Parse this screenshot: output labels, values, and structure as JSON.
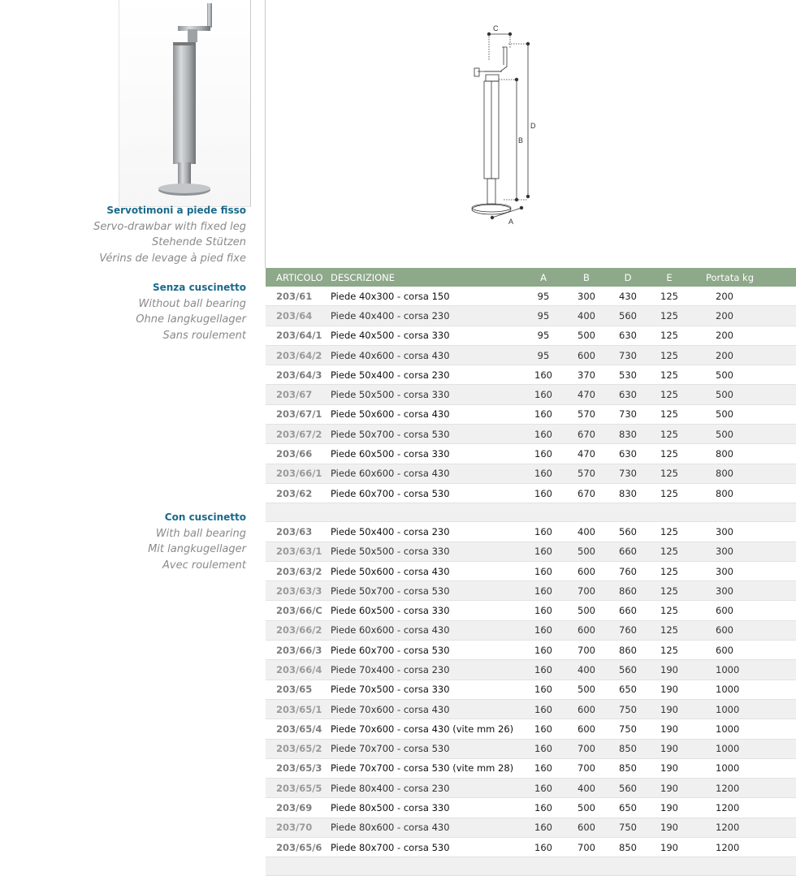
{
  "sections": {
    "main": {
      "title": "Servotimoni a piede fisso",
      "lines": [
        "Servo-drawbar with fixed leg",
        "Stehende Stützen",
        "Vérins de levage à pied fixe"
      ]
    },
    "without": {
      "title": "Senza cuscinetto",
      "lines": [
        "Without ball bearing",
        "Ohne langkugellager",
        "Sans roulement"
      ]
    },
    "with": {
      "title": "Con cuscinetto",
      "lines": [
        "With ball bearing",
        "Mit langkugellager",
        "Avec roulement"
      ]
    }
  },
  "diagram": {
    "labels": {
      "c": "C",
      "d": "D",
      "b": "B",
      "a": "A"
    }
  },
  "table": {
    "headers": [
      "ARTICOLO",
      "DESCRIZIONE",
      "A",
      "B",
      "D",
      "E",
      "Portata kg"
    ],
    "group1": [
      [
        "203/61",
        "Piede 40x300 - corsa 150",
        "95",
        "300",
        "430",
        "125",
        "200"
      ],
      [
        "203/64",
        "Piede 40x400 - corsa 230",
        "95",
        "400",
        "560",
        "125",
        "200"
      ],
      [
        "203/64/1",
        "Piede 40x500 - corsa 330",
        "95",
        "500",
        "630",
        "125",
        "200"
      ],
      [
        "203/64/2",
        "Piede 40x600 - corsa 430",
        "95",
        "600",
        "730",
        "125",
        "200"
      ],
      [
        "203/64/3",
        "Piede 50x400 - corsa 230",
        "160",
        "370",
        "530",
        "125",
        "500"
      ],
      [
        "203/67",
        "Piede 50x500 - corsa 330",
        "160",
        "470",
        "630",
        "125",
        "500"
      ],
      [
        "203/67/1",
        "Piede 50x600 - corsa 430",
        "160",
        "570",
        "730",
        "125",
        "500"
      ],
      [
        "203/67/2",
        "Piede 50x700 - corsa 530",
        "160",
        "670",
        "830",
        "125",
        "500"
      ],
      [
        "203/66",
        "Piede 60x500 - corsa 330",
        "160",
        "470",
        "630",
        "125",
        "800"
      ],
      [
        "203/66/1",
        "Piede 60x600 - corsa 430",
        "160",
        "570",
        "730",
        "125",
        "800"
      ],
      [
        "203/62",
        "Piede 60x700 - corsa 530",
        "160",
        "670",
        "830",
        "125",
        "800"
      ]
    ],
    "group2": [
      [
        "203/63",
        "Piede 50x400 - corsa 230",
        "160",
        "400",
        "560",
        "125",
        "300"
      ],
      [
        "203/63/1",
        "Piede 50x500 - corsa 330",
        "160",
        "500",
        "660",
        "125",
        "300"
      ],
      [
        "203/63/2",
        "Piede 50x600 - corsa 430",
        "160",
        "600",
        "760",
        "125",
        "300"
      ],
      [
        "203/63/3",
        "Piede 50x700 - corsa 530",
        "160",
        "700",
        "860",
        "125",
        "300"
      ],
      [
        "203/66/C",
        "Piede 60x500 - corsa 330",
        "160",
        "500",
        "660",
        "125",
        "600"
      ],
      [
        "203/66/2",
        "Piede 60x600 - corsa 430",
        "160",
        "600",
        "760",
        "125",
        "600"
      ],
      [
        "203/66/3",
        "Piede 60x700 - corsa 530",
        "160",
        "700",
        "860",
        "125",
        "600"
      ],
      [
        "203/66/4",
        "Piede 70x400 - corsa 230",
        "160",
        "400",
        "560",
        "190",
        "1000"
      ],
      [
        "203/65",
        "Piede 70x500 - corsa 330",
        "160",
        "500",
        "650",
        "190",
        "1000"
      ],
      [
        "203/65/1",
        "Piede 70x600 - corsa 430",
        "160",
        "600",
        "750",
        "190",
        "1000"
      ],
      [
        "203/65/4",
        "Piede 70x600 - corsa 430 (vite mm 26)",
        "160",
        "600",
        "750",
        "190",
        "1000"
      ],
      [
        "203/65/2",
        "Piede 70x700 - corsa 530",
        "160",
        "700",
        "850",
        "190",
        "1000"
      ],
      [
        "203/65/3",
        "Piede 70x700 - corsa 530 (vite mm 28)",
        "160",
        "700",
        "850",
        "190",
        "1000"
      ],
      [
        "203/65/5",
        "Piede 80x400 - corsa 230",
        "160",
        "400",
        "560",
        "190",
        "1200"
      ],
      [
        "203/69",
        "Piede 80x500 - corsa 330",
        "160",
        "500",
        "650",
        "190",
        "1200"
      ],
      [
        "203/70",
        "Piede 80x600 - corsa 430",
        "160",
        "600",
        "750",
        "190",
        "1200"
      ],
      [
        "203/65/6",
        "Piede 80x700 - corsa 530",
        "160",
        "700",
        "850",
        "190",
        "1200"
      ]
    ]
  }
}
